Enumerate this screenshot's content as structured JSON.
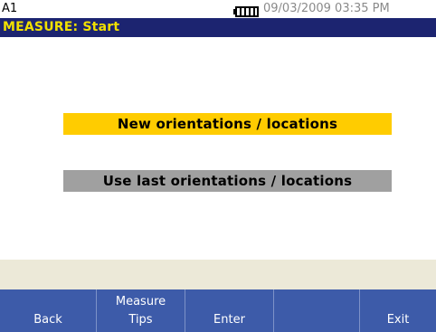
{
  "status": {
    "device_id": "A1",
    "datetime": "09/03/2009 03:35 PM"
  },
  "title": "MEASURE: Start",
  "options": [
    {
      "label": "New orientations / locations",
      "state": "selected",
      "color": "#ffcc00"
    },
    {
      "label": "Use last orientations / locations",
      "state": "unselected",
      "color": "#a0a0a0"
    }
  ],
  "softkeys": [
    {
      "line1": "",
      "line2": "Back"
    },
    {
      "line1": "Measure",
      "line2": "Tips"
    },
    {
      "line1": "",
      "line2": "Enter"
    },
    {
      "line1": "",
      "line2": ""
    },
    {
      "line1": "",
      "line2": "Exit"
    }
  ],
  "colors": {
    "title_bar": "#1c2470",
    "title_text": "#f0e000",
    "softkey_bar": "#3d5ba9",
    "info_strip": "#ece9d8"
  },
  "icons": {
    "battery": "battery-icon"
  }
}
